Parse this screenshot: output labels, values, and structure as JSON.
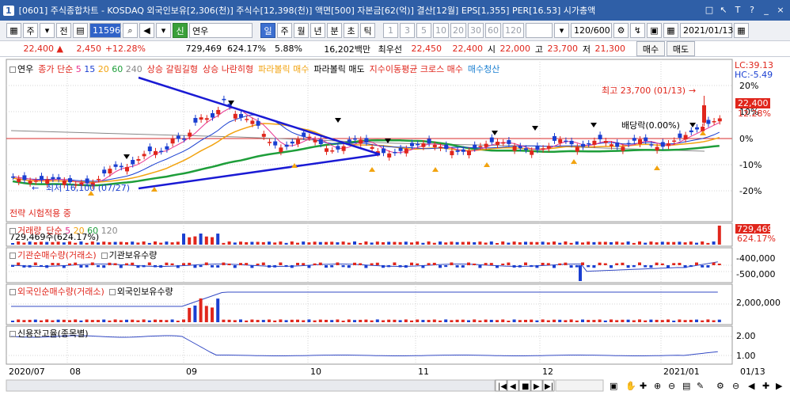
{
  "window": {
    "number": "1",
    "title": "[0601] 주식종합차트 - KOSDAQ 외국인보유[2,306(천)] 주식수[12,398(천)] 액면[500] 자본금[62(억)] 결산[12월] EPS[1,355] PER[16.53] 시가총액",
    "buttons": [
      "□",
      "↖",
      "T",
      "?",
      "_",
      "×"
    ]
  },
  "toolbar": {
    "market": "주",
    "prev_label": "전",
    "code": "115960",
    "stock_name": "연우",
    "periods": [
      "일",
      "주",
      "월",
      "년",
      "분",
      "초",
      "틱"
    ],
    "minutes": [
      "1",
      "3",
      "5",
      "10",
      "20",
      "30",
      "60",
      "120"
    ],
    "count": "120/600",
    "date": "2021/01/13",
    "buy_label": "매수",
    "sell_label": "매도"
  },
  "price": {
    "current": "22,400 ▲",
    "change": "2,450",
    "rate": "+12.28%",
    "volume": "729,469",
    "vol_rate": "624.17%",
    "turnover": "5.88%",
    "amount": "16,202백만",
    "best_ask_label": "최우선",
    "best_ask": "22,450",
    "best_bid": "22,400",
    "open_label": "시",
    "open": "22,000",
    "high_label": "고",
    "high": "23,700",
    "low_label": "저",
    "low": "21,300"
  },
  "main_chart": {
    "legend": {
      "name": "연우",
      "price_ma": "종가 단순",
      "ma5": "5",
      "ma15": "15",
      "ma20": "20",
      "ma60": "60",
      "ma240": "240",
      "sig1": "상승 갈림길형",
      "sig2": "상승 나란히형",
      "sig3": "파라볼릭 매수",
      "sig4": "파라볼릭 매도",
      "sig5": "지수이동평균 크로스 매수",
      "sig6": "매수청산"
    },
    "lc": "LC:39.13",
    "hc": "HC:-5.49",
    "high_note": "최고 23,700 (01/13)",
    "low_note": "최저 16,100 (07/27)",
    "dividend_note": "배당락(0.00%)",
    "strategy_note": "전략 시험적용 중",
    "last_price": "22,400",
    "last_rate": "12.28%",
    "y_ticks": [
      "20%",
      "10%",
      "0%",
      "-10%",
      "-20%"
    ]
  },
  "volume_panel": {
    "legend": "거래량",
    "ma_label": "단순",
    "ma5": "5",
    "ma20": "20",
    "ma60": "60",
    "ma120": "120",
    "value_text": "729,469주(624.17%)",
    "badge_value": "729,469",
    "badge_rate": "624.17%"
  },
  "inst_panel": {
    "legend1": "기관순매수량(거래소)",
    "legend2": "기관보유수량",
    "y_ticks": [
      "-400,000",
      "-500,000"
    ]
  },
  "foreign_panel": {
    "legend1": "외국인순매수량(거래소)",
    "legend2": "외국인보유수량",
    "y_ticks": [
      "2,000,000"
    ]
  },
  "credit_panel": {
    "legend": "신용잔고율(종목별)",
    "y_ticks": [
      "2.00",
      "1.00"
    ]
  },
  "x_axis": {
    "labels": [
      "2020/07",
      "08",
      "09",
      "10",
      "11",
      "12",
      "2021/01"
    ],
    "right_label": "01/13"
  },
  "colors": {
    "up": "#e0261c",
    "down": "#1a3fd1",
    "ma5": "#e8338e",
    "ma15": "#1a3fd1",
    "ma20": "#f2a30f",
    "ma60": "#1e9e3a",
    "ma240": "#888888",
    "trend": "#1a1ad4"
  }
}
